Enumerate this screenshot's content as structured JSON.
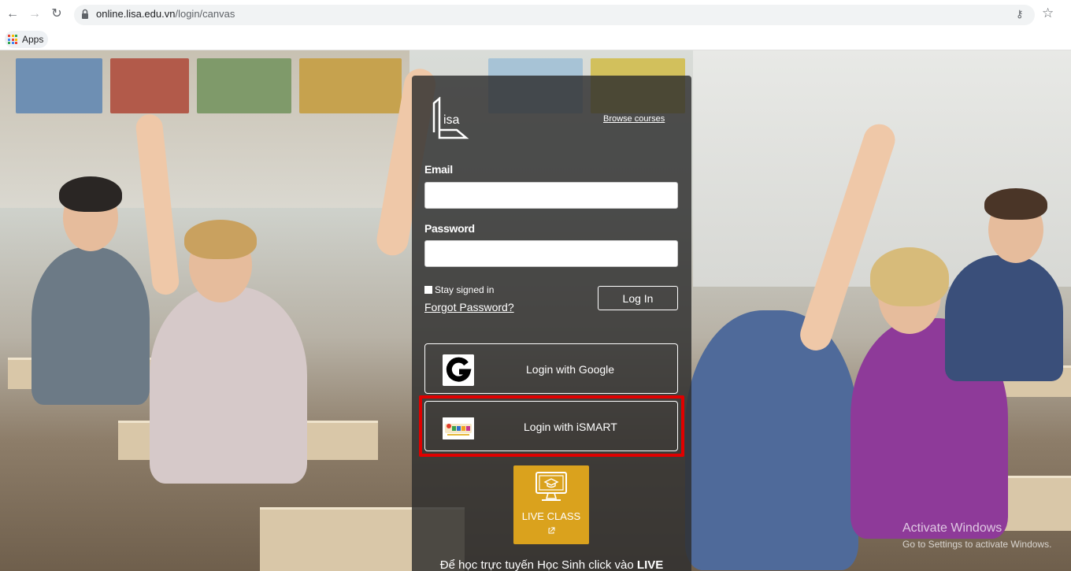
{
  "browser": {
    "url_host": "online.lisa.edu.vn",
    "url_path": "/login/canvas",
    "bookmarks": {
      "apps_label": "Apps"
    }
  },
  "panel": {
    "logo_text": "isa",
    "browse_courses": "Browse courses",
    "email_label": "Email",
    "email_value": "",
    "password_label": "Password",
    "password_value": "",
    "stay_signed_in": "Stay signed in",
    "forgot_password": "Forgot Password?",
    "login_button": "Log In",
    "google_login": "Login with Google",
    "ismart_login": "Login with iSMART",
    "live_class": "LIVE CLASS",
    "footer_prefix": "Để học trực tuyến Học Sinh click vào ",
    "footer_bold": "LIVE"
  },
  "watermark": {
    "title": "Activate Windows",
    "subtitle": "Go to Settings to activate Windows."
  },
  "colors": {
    "panel_bg": "#2d2d2d",
    "live_class_bg": "#daa21d",
    "highlight_border": "#e00000"
  }
}
